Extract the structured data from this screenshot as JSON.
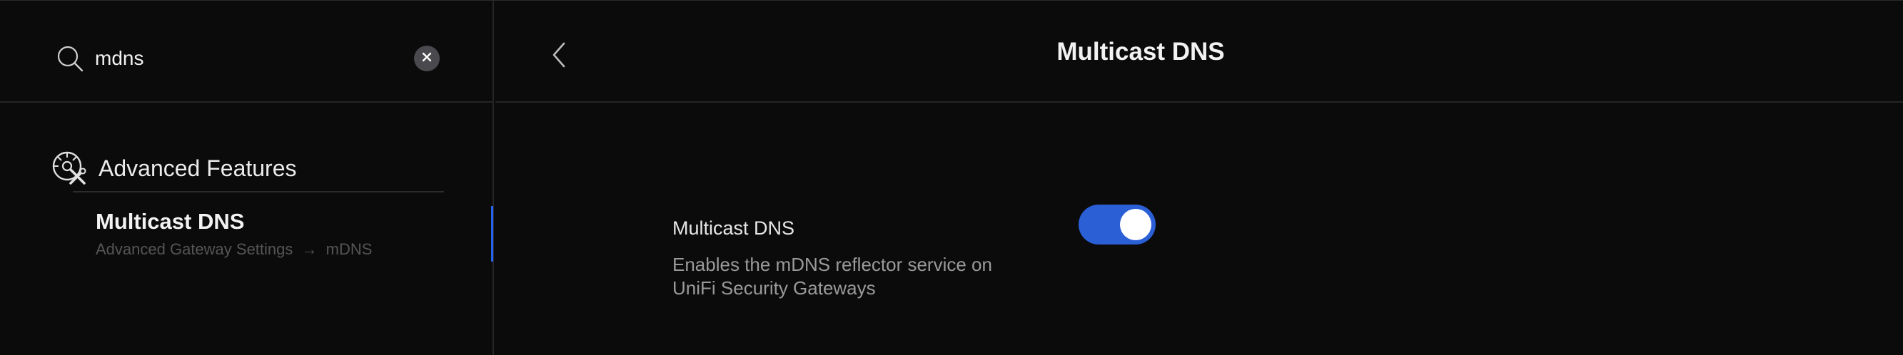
{
  "search": {
    "value": "mdns",
    "icon": "search-icon",
    "clear_icon": "close-icon"
  },
  "section": {
    "title": "Advanced Features",
    "icon": "tools-icon"
  },
  "result": {
    "title": "Multicast DNS",
    "path": [
      "Advanced Gateway Settings",
      "mDNS"
    ],
    "separator": "→"
  },
  "header": {
    "title": "Multicast DNS",
    "back_icon": "chevron-left-icon"
  },
  "setting": {
    "label": "Multicast DNS",
    "description": "Enables the mDNS reflector service on UniFi Security Gateways",
    "enabled": true
  },
  "colors": {
    "accent": "#2a5fd6",
    "background": "#0b0b0b",
    "divider": "#262626"
  }
}
